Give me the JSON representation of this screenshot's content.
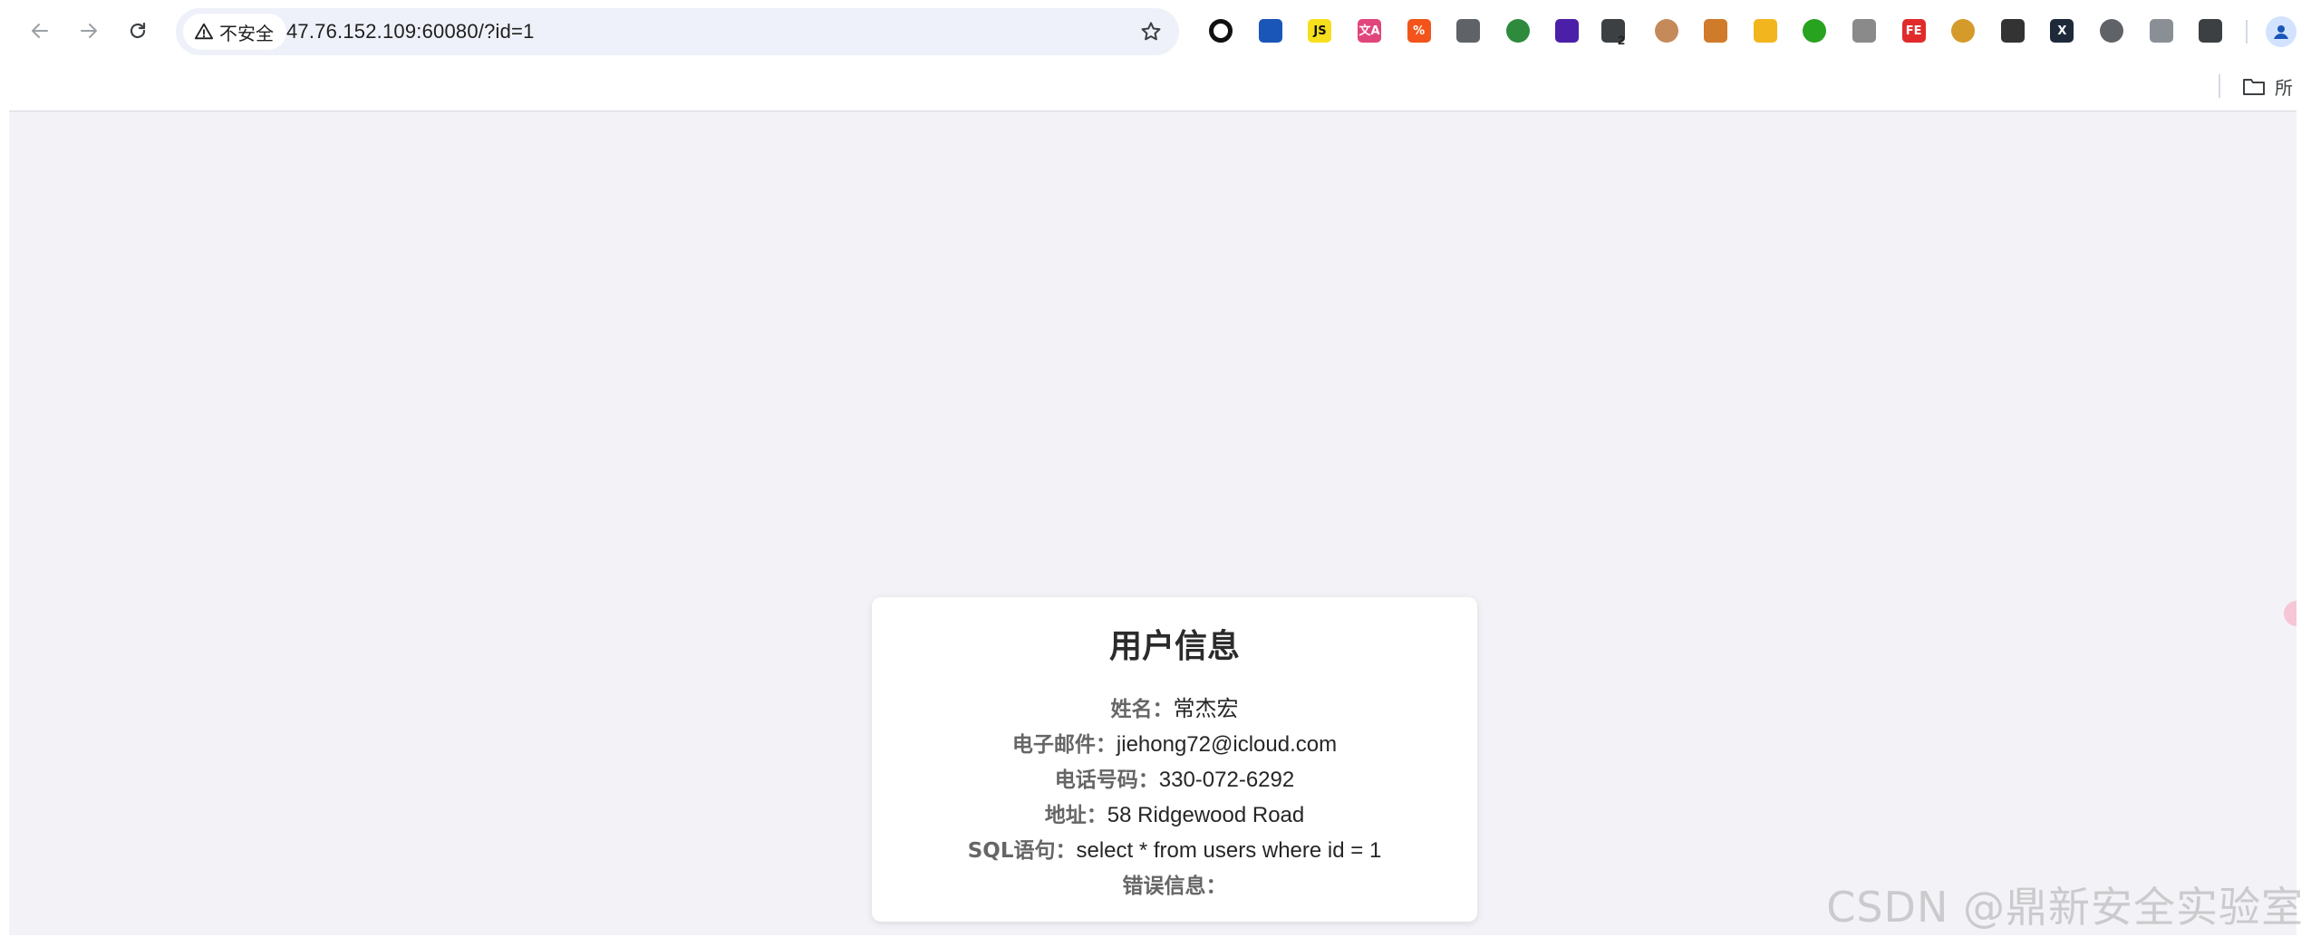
{
  "browser": {
    "security_label": "不安全",
    "url": "47.76.152.109:60080/?id=1",
    "extensions": [
      {
        "icon": "circle-ring-icon",
        "color": "#111111"
      },
      {
        "icon": "triangle-a-icon",
        "color": "#1a56b8"
      },
      {
        "icon": "js-icon",
        "label": "JS",
        "color": "#f7df1e"
      },
      {
        "icon": "translate-icon",
        "label": "文A",
        "color": "#e0457b"
      },
      {
        "icon": "percent-icon",
        "label": "%",
        "color": "#f2541b"
      },
      {
        "icon": "puzzle-person-icon",
        "color": "#5f6368"
      },
      {
        "icon": "add-pin-icon",
        "color": "#2e8b3e"
      },
      {
        "icon": "layers-icon",
        "color": "#4b1fa8"
      },
      {
        "icon": "selection-icon",
        "badge": "2",
        "color": "#3c4043"
      },
      {
        "icon": "diamond-icon",
        "color": "#c48a5a"
      },
      {
        "icon": "cookie-icon",
        "color": "#d07b2a"
      },
      {
        "icon": "moon-icon",
        "color": "#f2b51d"
      },
      {
        "icon": "globe-icon",
        "color": "#27a31f"
      },
      {
        "icon": "vue-icon",
        "color": "#8a8a8a"
      },
      {
        "icon": "fe-icon",
        "label": "FE",
        "color": "#e12b2b"
      },
      {
        "icon": "bow-icon",
        "color": "#d49b2a"
      },
      {
        "icon": "planet-icon",
        "color": "#333333"
      },
      {
        "icon": "x-icon",
        "label": "X",
        "color": "#1e2a3a"
      },
      {
        "icon": "copy-icon",
        "color": "#5f6368"
      },
      {
        "icon": "link-icon",
        "color": "#8a8f96"
      },
      {
        "icon": "extensions-puzzle-icon",
        "color": "#3c4043"
      }
    ],
    "bookmarks": {
      "all_bookmarks_label": "所"
    }
  },
  "card": {
    "title": "用户信息",
    "rows": [
      {
        "label": "姓名：",
        "value": "常杰宏"
      },
      {
        "label": "电子邮件：",
        "value": "jiehong72@icloud.com"
      },
      {
        "label": "电话号码：",
        "value": "330-072-6292"
      },
      {
        "label": "地址：",
        "value": "58 Ridgewood Road"
      },
      {
        "label": "SQL语句：",
        "value": "select * from users where id = 1"
      },
      {
        "label": "错误信息：",
        "value": ""
      }
    ]
  },
  "watermark": "CSDN @鼎新安全实验室",
  "colors": {
    "page_background": "#f3f2f7",
    "card_background": "#ffffff",
    "omnibox_background": "#eef1f9"
  }
}
